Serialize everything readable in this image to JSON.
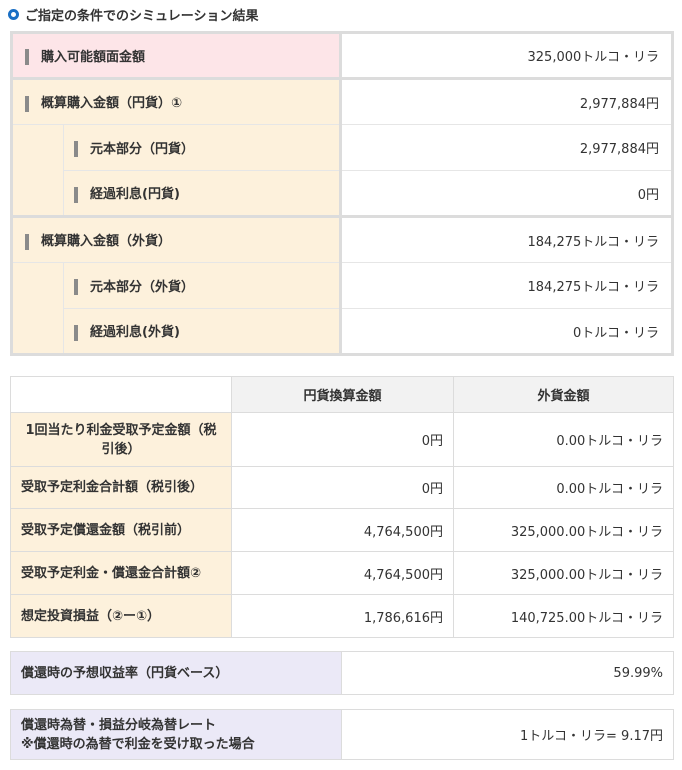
{
  "title": "ご指定の条件でのシミュレーション結果",
  "summary": {
    "purchasable_face_value": {
      "label": "購入可能額面金額",
      "value": "325,000トルコ・リラ"
    },
    "jpy_group": {
      "label": "概算購入金額（円貨）①",
      "value": "2,977,884円",
      "principal": {
        "label": "元本部分（円貨）",
        "value": "2,977,884円"
      },
      "accrued_interest": {
        "label": "経過利息(円貨)",
        "value": "0円"
      }
    },
    "fx_group": {
      "label": "概算購入金額（外貨）",
      "value": "184,275トルコ・リラ",
      "principal": {
        "label": "元本部分（外貨）",
        "value": "184,275トルコ・リラ"
      },
      "accrued_interest": {
        "label": "経過利息(外貨)",
        "value": "0トルコ・リラ"
      }
    }
  },
  "detail": {
    "headers": {
      "jpy": "円貨換算金額",
      "fx": "外貨金額"
    },
    "rows": [
      {
        "label": "1回当たり利金受取予定金額（税引後）",
        "jpy": "0円",
        "fx": "0.00トルコ・リラ"
      },
      {
        "label": "受取予定利金合計額（税引後）",
        "jpy": "0円",
        "fx": "0.00トルコ・リラ"
      },
      {
        "label": "受取予定償還金額（税引前）",
        "jpy": "4,764,500円",
        "fx": "325,000.00トルコ・リラ"
      },
      {
        "label": "受取予定利金・償還金合計額②",
        "jpy": "4,764,500円",
        "fx": "325,000.00トルコ・リラ"
      },
      {
        "label": "想定投資損益（②ー①）",
        "jpy": "1,786,616円",
        "fx": "140,725.00トルコ・リラ"
      }
    ]
  },
  "yield": {
    "label": "償還時の予想収益率（円貨ベース）",
    "value": "59.99%"
  },
  "breakeven": {
    "label_line1": "償還時為替・損益分岐為替レート",
    "label_line2": "※償還時の為替で利金を受け取った場合",
    "value": "1トルコ・リラ= 9.17円"
  },
  "colors": {
    "accent": "#1a6fc4",
    "label_bg": "#fdf1dc",
    "highlight_bg": "#fde5e8",
    "yield_bg": "#ebe9f7"
  }
}
